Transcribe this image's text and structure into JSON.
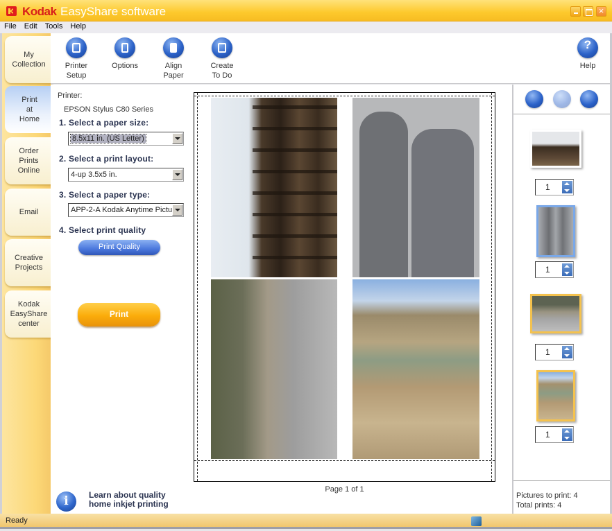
{
  "window": {
    "brand": "Kodak",
    "title": "EasyShare software",
    "controls": {
      "minimize": "minimize-icon",
      "maximize": "maximize-icon",
      "close": "×"
    }
  },
  "menu": [
    "File",
    "Edit",
    "Tools",
    "Help"
  ],
  "nav": [
    {
      "label": "My\nCollection",
      "active": false
    },
    {
      "label": "Print\nat\nHome",
      "active": true
    },
    {
      "label": "Order\nPrints\nOnline",
      "active": false
    },
    {
      "label": "Email",
      "active": false
    },
    {
      "label": "Creative\nProjects",
      "active": false
    },
    {
      "label": "Kodak\nEasyShare\ncenter",
      "active": false
    }
  ],
  "toolbar": {
    "items": [
      {
        "label": "Printer\nSetup",
        "icon": "printer-setup-icon"
      },
      {
        "label": "Options",
        "icon": "options-icon"
      },
      {
        "label": "Align\nPaper",
        "icon": "align-paper-icon"
      },
      {
        "label": "Create\nTo Do",
        "icon": "create-todo-icon"
      }
    ],
    "help": {
      "label": "Help",
      "glyph": "?"
    }
  },
  "settings": {
    "printer_label": "Printer:",
    "printer_name": "EPSON Stylus C80 Series",
    "step1": "1. Select a paper size:",
    "paper_size": "8.5x11 in. (US Letter)",
    "step2": "2. Select a print layout:",
    "print_layout": "4-up 3.5x5 in.",
    "step3": "3. Select a paper type:",
    "paper_type": "APP-2-A Kodak Anytime Pictu",
    "step4": "4. Select print quality",
    "quality_button": "Print Quality",
    "print_button": "Print"
  },
  "info": {
    "glyph": "i",
    "line1": "Learn about quality",
    "line2": "home inkjet printing"
  },
  "preview": {
    "page_label": "Page 1 of 1"
  },
  "right_panel": {
    "tools": [
      "add-picture-icon",
      "crop-icon",
      "remove-picture-icon"
    ],
    "pictures": [
      {
        "name": "trestle bridge",
        "copies": "1",
        "selected": false
      },
      {
        "name": "shadows",
        "copies": "1",
        "selected": "blue"
      },
      {
        "name": "rocky hillside road",
        "copies": "1",
        "selected": "yellow"
      },
      {
        "name": "colorful hills",
        "copies": "1",
        "selected": "yellow"
      }
    ],
    "pictures_to_print": "Pictures to print: 4",
    "total_prints": "Total prints: 4"
  },
  "status": {
    "text": "Ready"
  }
}
